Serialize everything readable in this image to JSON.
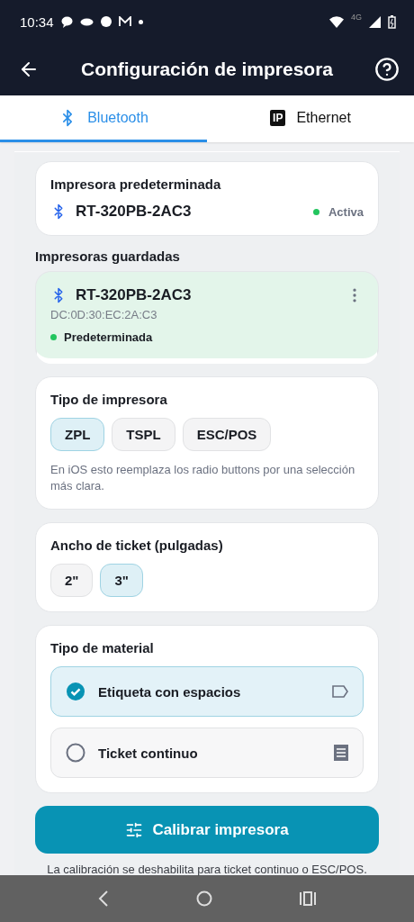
{
  "status_bar": {
    "time": "10:34",
    "network": "4G"
  },
  "app_bar": {
    "title": "Configuración de impresora"
  },
  "tabs": [
    {
      "label": "Bluetooth",
      "kind": "bluetooth",
      "selected": true
    },
    {
      "label": "Ethernet",
      "kind": "ip",
      "badge": "IP",
      "selected": false
    }
  ],
  "default_printer": {
    "heading": "Impresora predeterminada",
    "name": "RT-320PB-2AC3",
    "status": "Activa"
  },
  "saved_printers": {
    "heading": "Impresoras guardadas",
    "items": [
      {
        "name": "RT-320PB-2AC3",
        "address": "DC:0D:30:EC:2A:C3",
        "status": "Predeterminada",
        "selected": true
      }
    ]
  },
  "printer_type": {
    "heading": "Tipo de impresora",
    "options": [
      {
        "label": "ZPL",
        "selected": true
      },
      {
        "label": "TSPL",
        "selected": false
      },
      {
        "label": "ESC/POS",
        "selected": false
      }
    ],
    "note": "En iOS esto reemplaza los radio buttons por una selección más clara."
  },
  "ticket_width": {
    "heading": "Ancho de ticket (pulgadas)",
    "options": [
      {
        "label": "2\"",
        "selected": false
      },
      {
        "label": "3\"",
        "selected": true
      }
    ]
  },
  "material": {
    "heading": "Tipo de material",
    "options": [
      {
        "label": "Etiqueta con espacios",
        "kind": "label",
        "selected": true
      },
      {
        "label": "Ticket continuo",
        "kind": "ticket",
        "selected": false
      }
    ]
  },
  "calibrate_button": {
    "label": "Calibrar impresora"
  },
  "footnote": "La calibración se deshabilita para ticket continuo o ESC/POS."
}
